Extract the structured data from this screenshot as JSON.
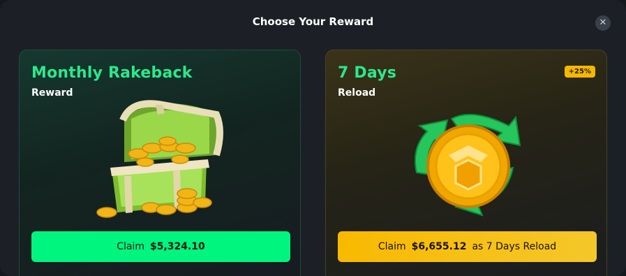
{
  "modal": {
    "title": "Choose Your Reward",
    "close_icon": "close-icon"
  },
  "cards": [
    {
      "title": "Monthly Rakeback",
      "subtitle": "Reward",
      "image": "treasure-chest-icon",
      "claim_label": "Claim",
      "claim_amount": "$5,324.10",
      "accent": "#00f57f"
    },
    {
      "title": "7 Days",
      "subtitle": "Reload",
      "badge": "+25%",
      "image": "coin-reload-icon",
      "claim_label": "Claim",
      "claim_amount": "$6,655.12",
      "claim_suffix": "as 7 Days Reload",
      "accent": "#f9b900"
    }
  ]
}
